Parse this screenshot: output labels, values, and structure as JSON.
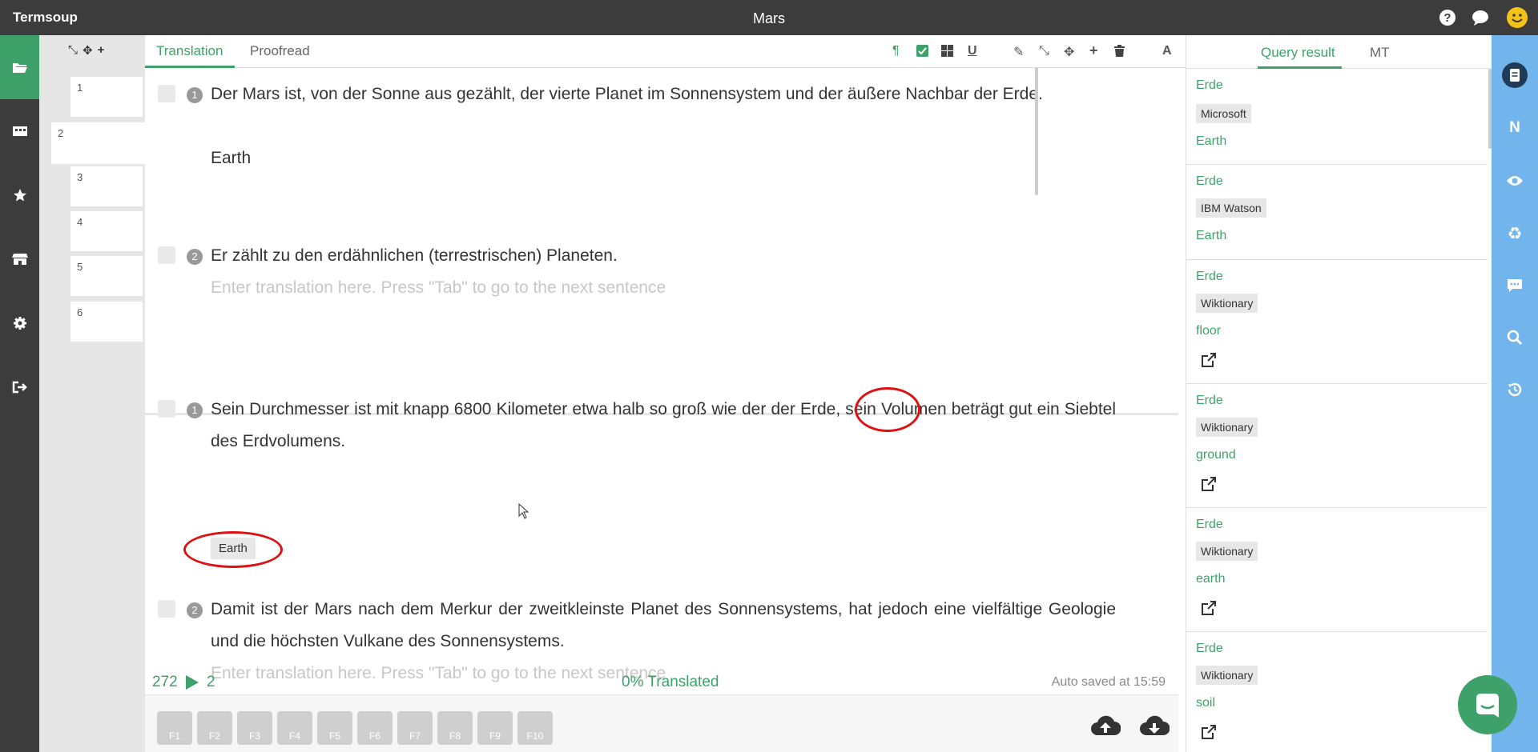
{
  "app": {
    "name": "Termsoup",
    "doc_title": "Mars"
  },
  "tabs": [
    "Translation",
    "Proofread"
  ],
  "pages": [
    "1",
    "2",
    "3",
    "4",
    "5",
    "6"
  ],
  "segments": [
    {
      "num": "1",
      "source": "Der Mars ist, von der Sonne aus gezählt, der vierte Planet im Sonnensystem und der äußere Nachbar der Erde.",
      "target": "Earth"
    },
    {
      "num": "2",
      "source": "Er zählt zu den erdähnlichen (terrestrischen) Planeten.",
      "placeholder": "Enter translation here. Press \"Tab\" to go to the next sentence"
    },
    {
      "num": "1",
      "source_before": "Sein Durchmesser ist mit knapp 6800 Kilometer etwa halb so groß wie der der ",
      "highlight": "Erde,",
      "source_after": " sein Volumen beträgt gut ein Siebtel des Erdvolumens.",
      "term_chip": "Earth"
    },
    {
      "num": "2",
      "source": "Damit ist der Mars nach dem Merkur der zweitkleinste Planet des Sonnensystems, hat jedoch eine vielfältige Geologie und die höchsten Vulkane des Sonnensystems.",
      "placeholder": "Enter translation here. Press \"Tab\" to go to the next sentence"
    }
  ],
  "status": {
    "words": "272",
    "segment": "2",
    "progress": "0% Translated",
    "autosave": "Auto saved at 15:59"
  },
  "fkeys": [
    "F1",
    "F2",
    "F3",
    "F4",
    "F5",
    "F6",
    "F7",
    "F8",
    "F9",
    "F10"
  ],
  "right_tabs": [
    "Query result",
    "MT"
  ],
  "query_results": [
    {
      "source": "Erde",
      "provider": "Microsoft",
      "target": "Earth"
    },
    {
      "source": "Erde",
      "provider": "IBM Watson",
      "target": "Earth"
    },
    {
      "source": "Erde",
      "provider": "Wiktionary",
      "target": "floor"
    },
    {
      "source": "Erde",
      "provider": "Wiktionary",
      "target": "ground"
    },
    {
      "source": "Erde",
      "provider": "Wiktionary",
      "target": "earth"
    },
    {
      "source": "Erde",
      "provider": "Wiktionary",
      "target": "soil"
    }
  ],
  "colors": {
    "accent": "#3fa16a",
    "dark": "#3c3c3c",
    "rail": "#72b4ec",
    "annotation": "#dd1111"
  }
}
